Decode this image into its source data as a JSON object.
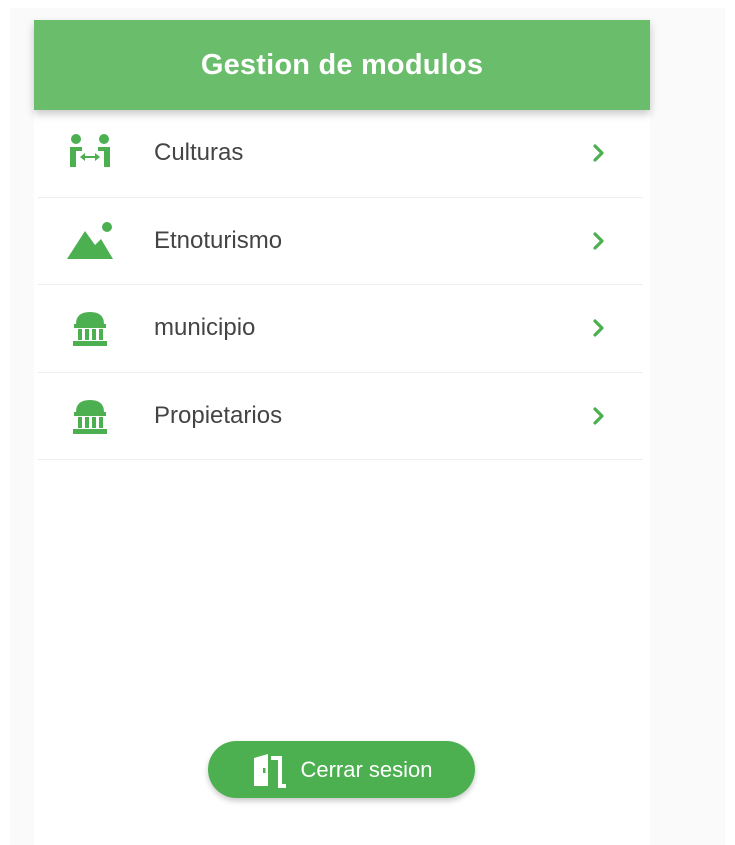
{
  "header": {
    "title": "Gestion de modulos"
  },
  "modules": [
    {
      "label": "Culturas",
      "icon": "people-exchange-icon"
    },
    {
      "label": "Etnoturismo",
      "icon": "landscape-icon"
    },
    {
      "label": "municipio",
      "icon": "museum-icon"
    },
    {
      "label": "Propietarios",
      "icon": "museum-icon"
    }
  ],
  "logout": {
    "label": "Cerrar sesion",
    "icon": "door-exit-icon"
  },
  "colors": {
    "header": "#6abd6b",
    "accent": "#4caf50",
    "text": "#444444"
  }
}
